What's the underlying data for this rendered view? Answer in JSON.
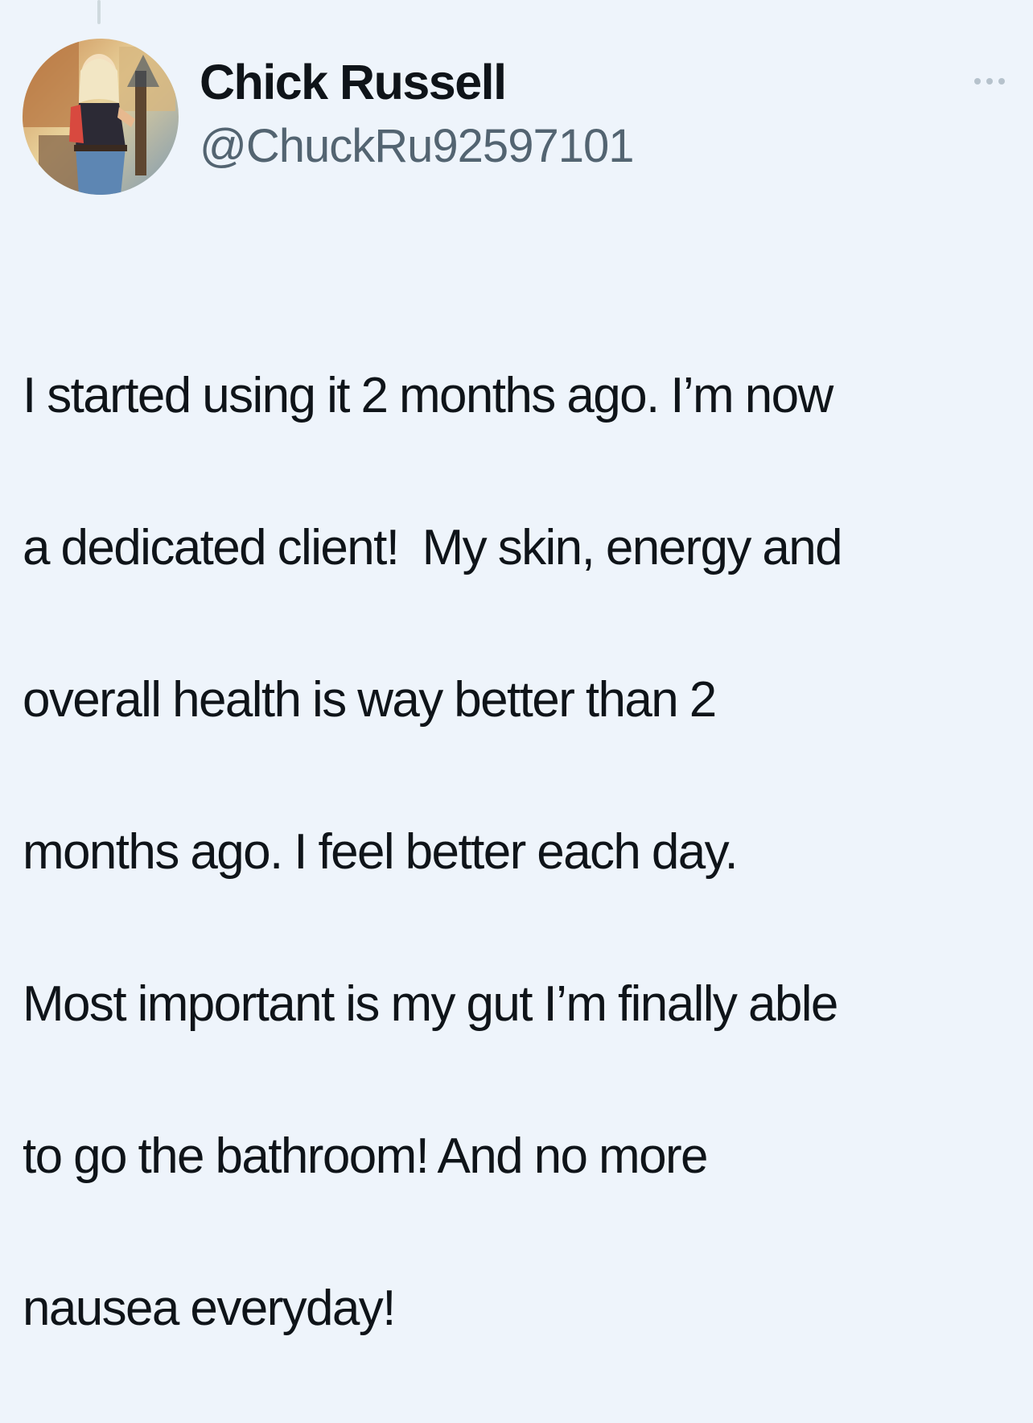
{
  "tweet": {
    "author": {
      "display_name": "Chick Russell",
      "handle": "@ChuckRu92597101",
      "avatar_icon": "profile-photo"
    },
    "more_icon": "ellipsis-icon",
    "text_lines": [
      "I started using it 2 months ago. I’m now",
      "a dedicated client!  My skin, energy and",
      "overall health is way better than 2",
      "months ago. I feel better each day.",
      "Most important is my gut I’m finally able",
      "to go the bathroom! And no more",
      "nausea everyday!"
    ]
  },
  "colors": {
    "background": "#eef4fb",
    "text": "#0f1419",
    "secondary": "#536471"
  }
}
